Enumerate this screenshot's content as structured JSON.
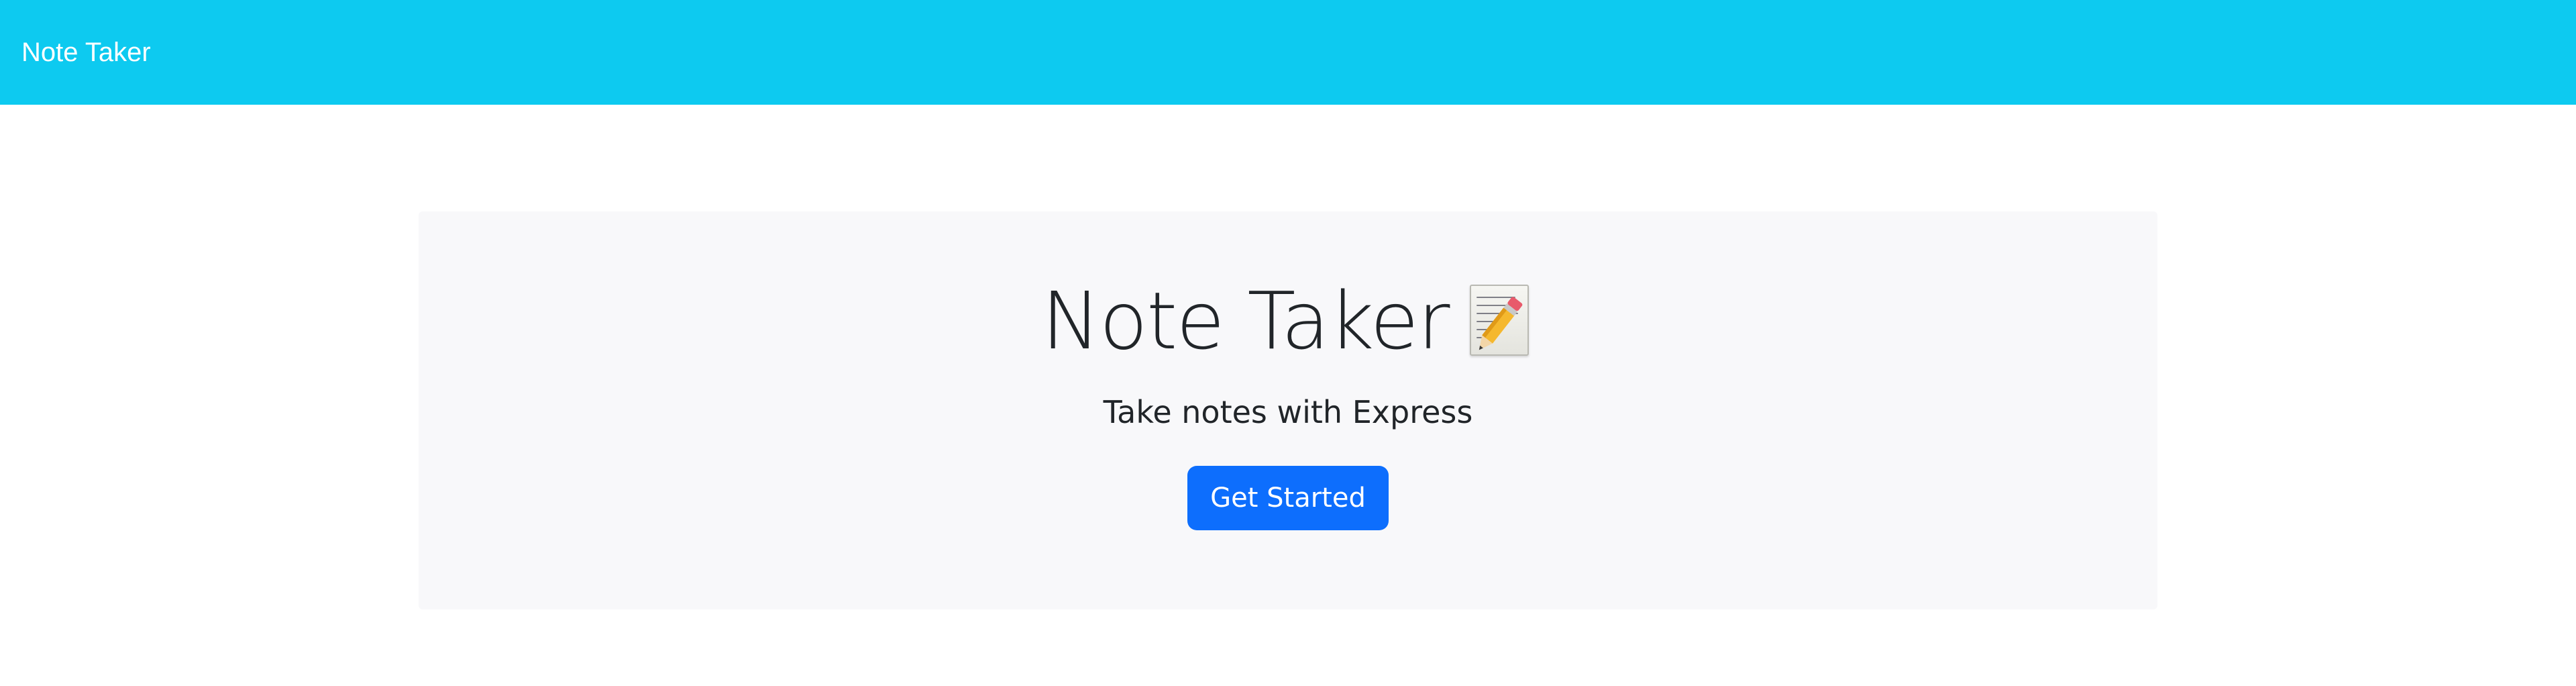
{
  "navbar": {
    "brand": "Note Taker",
    "background_color": "#0dcaf0"
  },
  "hero": {
    "title": "Note Taker",
    "title_icon": "memo-pencil-icon",
    "subtitle": "Take notes with Express",
    "cta_label": "Get Started",
    "cta_color": "#0d6efd"
  }
}
